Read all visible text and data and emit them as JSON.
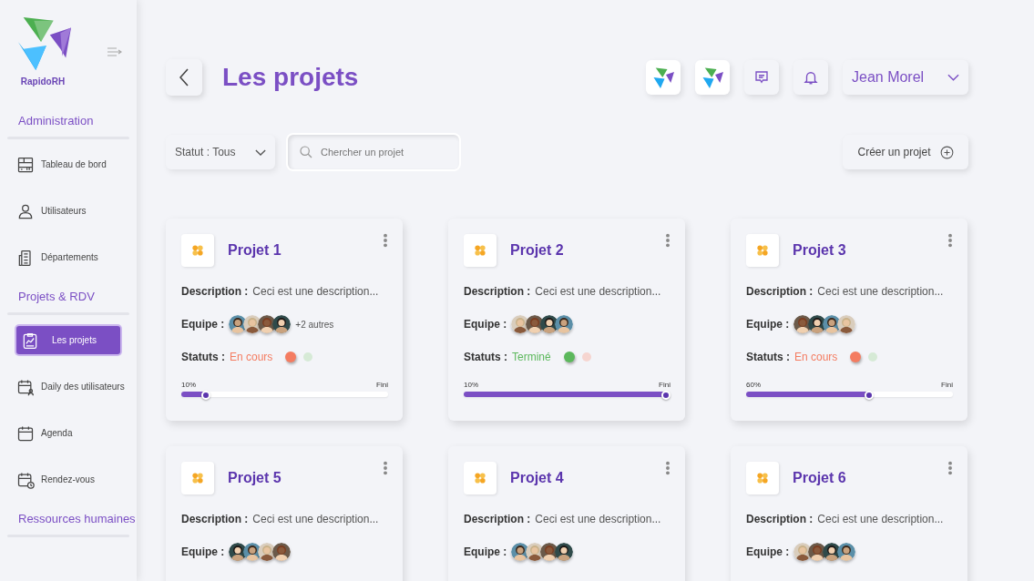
{
  "sidebar": {
    "brand": "RapidoRH",
    "sections": [
      {
        "title": "Administration",
        "items": [
          {
            "label": "Tableau de bord",
            "kind": "dashboard",
            "selected": false
          },
          {
            "label": "Utilisateurs",
            "kind": "user",
            "selected": false
          },
          {
            "label": "Départements",
            "kind": "building",
            "selected": false
          }
        ]
      },
      {
        "title": "Projets & RDV",
        "items": [
          {
            "label": "Les projets",
            "kind": "projects",
            "selected": true
          },
          {
            "label": "Daily des utilisateurs",
            "kind": "calendar-user",
            "selected": false
          },
          {
            "label": "Agenda",
            "kind": "calendar",
            "selected": false
          },
          {
            "label": "Rendez-vous",
            "kind": "calendar-clock",
            "selected": false
          }
        ]
      },
      {
        "title": "Ressources humaines"
      }
    ]
  },
  "header": {
    "title": "Les projets",
    "user": "Jean Morel"
  },
  "filters": {
    "status": "Statut : Tous",
    "search": {
      "placeholder": "Chercher un projet"
    },
    "create": "Créer un projet"
  },
  "projects": [
    {
      "name": "Projet 1",
      "description_label": "Description :",
      "description": "Ceci est une description...",
      "team_label": "Equipe :",
      "team_extra": "+2 autres",
      "status": {
        "label": "Statuts :",
        "value": "En cours",
        "color": "#f47c61",
        "dots": [
          {
            "color": "#f47c61",
            "selected": true
          },
          {
            "color": "#d6ead6",
            "selected": false
          }
        ]
      },
      "progress": {
        "reading": "10%",
        "end": "Fini",
        "level": 0.1
      }
    },
    {
      "name": "Projet 2",
      "description_label": "Description :",
      "description": "Ceci est une description...",
      "team_label": "Equipe :",
      "status": {
        "label": "Statuts :",
        "value": "Terminé",
        "color": "#5cb85c",
        "dots": [
          {
            "color": "#5cb85c",
            "selected": true
          },
          {
            "color": "#f6d5d0",
            "selected": false
          }
        ]
      },
      "progress": {
        "reading": "10%",
        "end": "Fini",
        "level": 1
      }
    },
    {
      "name": "Projet 3",
      "description_label": "Description :",
      "description": "Ceci est une description...",
      "team_label": "Equipe :",
      "status": {
        "label": "Statuts :",
        "value": "En cours",
        "color": "#f47c61",
        "dots": [
          {
            "color": "#f47c61",
            "selected": true
          },
          {
            "color": "#d6ead6",
            "selected": false
          }
        ]
      },
      "progress": {
        "reading": "60%",
        "end": "Fini",
        "level": 0.6
      }
    },
    {
      "name": "Projet 5",
      "description_label": "Description :",
      "description": "Ceci est une description...",
      "team_label": "Equipe :"
    },
    {
      "name": "Projet 4",
      "description_label": "Description :",
      "description": "Ceci est une description...",
      "team_label": "Equipe :"
    },
    {
      "name": "Projet 6",
      "description_label": "Description :",
      "description": "Ceci est une description...",
      "team_label": "Equipe :"
    }
  ]
}
